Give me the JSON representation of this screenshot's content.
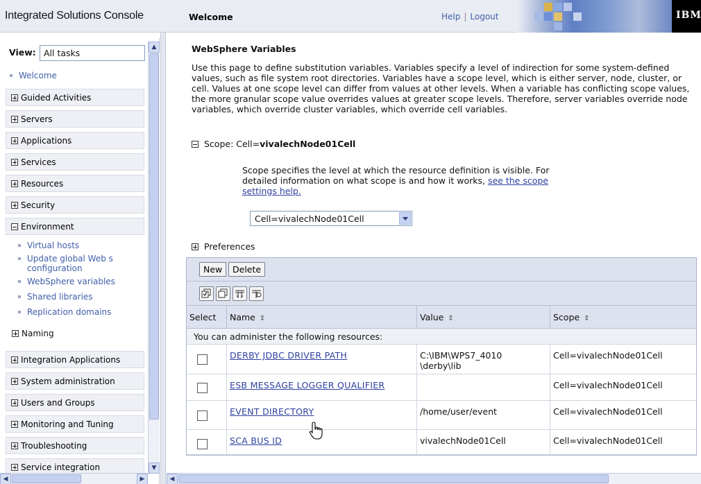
{
  "header": {
    "app_title": "Integrated Solutions Console",
    "page_title": "Welcome",
    "help_label": "Help",
    "separator": "|",
    "logout_label": "Logout",
    "brand_logo": "IBM"
  },
  "sidebar": {
    "view_label": "View:",
    "view_value": "All tasks",
    "welcome": "Welcome",
    "items": [
      {
        "label": "Guided Activities",
        "state": "collapsed"
      },
      {
        "label": "Servers",
        "state": "collapsed"
      },
      {
        "label": "Applications",
        "state": "collapsed"
      },
      {
        "label": "Services",
        "state": "collapsed"
      },
      {
        "label": "Resources",
        "state": "collapsed"
      },
      {
        "label": "Security",
        "state": "collapsed"
      },
      {
        "label": "Environment",
        "state": "expanded"
      },
      {
        "label": "Integration Applications",
        "state": "collapsed"
      },
      {
        "label": "System administration",
        "state": "collapsed"
      },
      {
        "label": "Users and Groups",
        "state": "collapsed"
      },
      {
        "label": "Monitoring and Tuning",
        "state": "collapsed"
      },
      {
        "label": "Troubleshooting",
        "state": "collapsed"
      },
      {
        "label": "Service integration",
        "state": "collapsed"
      }
    ],
    "environment_children": [
      "Virtual hosts",
      "Update global Web s",
      "configuration",
      "WebSphere variables",
      "Shared libraries",
      "Replication domains"
    ],
    "naming_label": "Naming"
  },
  "main": {
    "section_title": "WebSphere Variables",
    "description": "Use this page to define substitution variables. Variables specify a level of indirection for some system-defined values, such as file system root directories. Variables have a scope level, which is either server, node, cluster, or cell. Values at one scope level can differ from values at other levels. When a variable has conflicting scope values, the more granular scope value overrides values at greater scope levels. Therefore, server variables override node variables, which override cluster variables, which override cell variables.",
    "scope_header_prefix": "Scope: Cell=",
    "scope_header_value": "vivalechNode01Cell",
    "scope_desc_text": "Scope specifies the level at which the resource definition is visible. For detailed information on what scope is and how it works,",
    "scope_help_link": "see the scope settings help.",
    "scope_select_value": "Cell=vivalechNode01Cell",
    "preferences_label": "Preferences",
    "buttons": {
      "new": "New",
      "delete": "Delete"
    },
    "toolbar_icons": [
      "select-all-icon",
      "deselect-all-icon",
      "expand-filter-icon",
      "clear-filter-icon"
    ],
    "table": {
      "columns": [
        "Select",
        "Name",
        "Value",
        "Scope"
      ],
      "info_row": "You can administer the following resources:",
      "rows": [
        {
          "name": "DERBY JDBC DRIVER PATH",
          "value": "C:\\IBM\\WPS7_4010\n\\derby\\lib",
          "scope": "Cell=vivalechNode01Cell"
        },
        {
          "name": "ESB MESSAGE LOGGER QUALIFIER",
          "value": "",
          "scope": "Cell=vivalechNode01Cell"
        },
        {
          "name": "EVENT DIRECTORY",
          "value": "/home/user/event",
          "scope": "Cell=vivalechNode01Cell"
        },
        {
          "name": "SCA BUS ID",
          "value": "vivalechNode01Cell",
          "scope": "Cell=vivalechNode01Cell"
        }
      ]
    }
  },
  "colors": {
    "link": "#3f5da8",
    "header_bg": "#e9ecf3",
    "table_header_bg": "#dde2ee",
    "sidebar_item_bg": "#eef0f5"
  }
}
